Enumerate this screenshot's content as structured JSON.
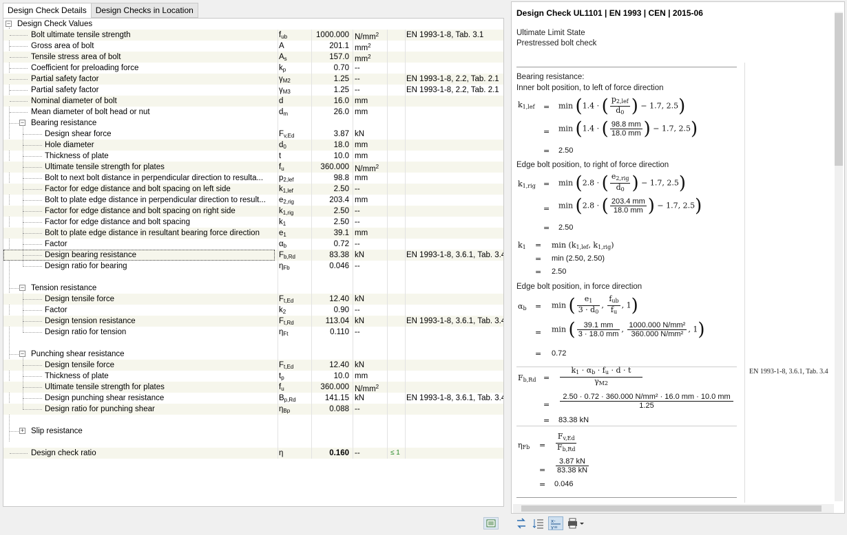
{
  "tabs": [
    "Design Check Details",
    "Design Checks in Location"
  ],
  "root_label": "Design Check Values",
  "rows": [
    {
      "lbl": "Bolt ultimate tensile strength",
      "sym": "f<sub>ub</sub>",
      "val": "1000.000",
      "unit": "N/mm<sup>2</sup>",
      "ref": "EN 1993-1-8, Tab. 3.1"
    },
    {
      "lbl": "Gross area of bolt",
      "sym": "A",
      "val": "201.1",
      "unit": "mm<sup>2</sup>",
      "ref": ""
    },
    {
      "lbl": "Tensile stress area of bolt",
      "sym": "A<sub>s</sub>",
      "val": "157.0",
      "unit": "mm<sup>2</sup>",
      "ref": ""
    },
    {
      "lbl": "Coefficient for preloading force",
      "sym": "k<sub>p</sub>",
      "val": "0.70",
      "unit": "--",
      "ref": ""
    },
    {
      "lbl": "Partial safety factor",
      "sym": "γ<sub>M2</sub>",
      "val": "1.25",
      "unit": "--",
      "ref": "EN 1993-1-8, 2.2, Tab. 2.1"
    },
    {
      "lbl": "Partial safety factor",
      "sym": "γ<sub>M3</sub>",
      "val": "1.25",
      "unit": "--",
      "ref": "EN 1993-1-8, 2.2, Tab. 2.1"
    },
    {
      "lbl": "Nominal diameter of bolt",
      "sym": "d",
      "val": "16.0",
      "unit": "mm",
      "ref": ""
    },
    {
      "lbl": "Mean diameter of bolt head or nut",
      "sym": "d<sub>m</sub>",
      "val": "26.0",
      "unit": "mm",
      "ref": ""
    },
    {
      "group": "Bearing resistance"
    },
    {
      "lbl": "Design shear force",
      "sym": "F<sub>v,Ed</sub>",
      "val": "3.87",
      "unit": "kN",
      "ref": "",
      "lvl": 2
    },
    {
      "lbl": "Hole diameter",
      "sym": "d<sub>0</sub>",
      "val": "18.0",
      "unit": "mm",
      "ref": "",
      "lvl": 2
    },
    {
      "lbl": "Thickness of plate",
      "sym": "t",
      "val": "10.0",
      "unit": "mm",
      "ref": "",
      "lvl": 2
    },
    {
      "lbl": "Ultimate tensile strength for plates",
      "sym": "f<sub>u</sub>",
      "val": "360.000",
      "unit": "N/mm<sup>2</sup>",
      "ref": "",
      "lvl": 2
    },
    {
      "lbl": "Bolt to next bolt distance in perpendicular direction to resulta...",
      "sym": "p<sub>2,lef</sub>",
      "val": "98.8",
      "unit": "mm",
      "ref": "",
      "lvl": 2
    },
    {
      "lbl": "Factor for edge distance and bolt spacing on left side",
      "sym": "k<sub>1,lef</sub>",
      "val": "2.50",
      "unit": "--",
      "ref": "",
      "lvl": 2
    },
    {
      "lbl": "Bolt to plate edge distance in perpendicular direction to result...",
      "sym": "e<sub>2,rig</sub>",
      "val": "203.4",
      "unit": "mm",
      "ref": "",
      "lvl": 2
    },
    {
      "lbl": "Factor for edge distance and bolt spacing on right side",
      "sym": "k<sub>1,rig</sub>",
      "val": "2.50",
      "unit": "--",
      "ref": "",
      "lvl": 2
    },
    {
      "lbl": "Factor for edge distance and bolt spacing",
      "sym": "k<sub>1</sub>",
      "val": "2.50",
      "unit": "--",
      "ref": "",
      "lvl": 2
    },
    {
      "lbl": "Bolt to plate edge distance in resultant bearing force direction",
      "sym": "e<sub>1</sub>",
      "val": "39.1",
      "unit": "mm",
      "ref": "",
      "lvl": 2
    },
    {
      "lbl": "Factor",
      "sym": "α<sub>b</sub>",
      "val": "0.72",
      "unit": "--",
      "ref": "",
      "lvl": 2
    },
    {
      "lbl": "Design bearing resistance",
      "sym": "F<sub>b,Rd</sub>",
      "val": "83.38",
      "unit": "kN",
      "ref": "EN 1993-1-8, 3.6.1, Tab. 3.4",
      "lvl": 2,
      "sel": true
    },
    {
      "lbl": "Design ratio for bearing",
      "sym": "η<sub>Fb</sub>",
      "val": "0.046",
      "unit": "--",
      "ref": "",
      "lvl": 2
    },
    {
      "blank": true
    },
    {
      "group": "Tension resistance"
    },
    {
      "lbl": "Design tensile force",
      "sym": "F<sub>t,Ed</sub>",
      "val": "12.40",
      "unit": "kN",
      "ref": "",
      "lvl": 2
    },
    {
      "lbl": "Factor",
      "sym": "k<sub>2</sub>",
      "val": "0.90",
      "unit": "--",
      "ref": "",
      "lvl": 2
    },
    {
      "lbl": "Design tension resistance",
      "sym": "F<sub>t,Rd</sub>",
      "val": "113.04",
      "unit": "kN",
      "ref": "EN 1993-1-8, 3.6.1, Tab. 3.4",
      "lvl": 2
    },
    {
      "lbl": "Design ratio for tension",
      "sym": "η<sub>Ft</sub>",
      "val": "0.110",
      "unit": "--",
      "ref": "",
      "lvl": 2
    },
    {
      "blank": true
    },
    {
      "group": "Punching shear resistance"
    },
    {
      "lbl": "Design tensile force",
      "sym": "F<sub>t,Ed</sub>",
      "val": "12.40",
      "unit": "kN",
      "ref": "",
      "lvl": 2
    },
    {
      "lbl": "Thickness of plate",
      "sym": "t<sub>p</sub>",
      "val": "10.0",
      "unit": "mm",
      "ref": "",
      "lvl": 2
    },
    {
      "lbl": "Ultimate tensile strength for plates",
      "sym": "f<sub>u</sub>",
      "val": "360.000",
      "unit": "N/mm<sup>2</sup>",
      "ref": "",
      "lvl": 2
    },
    {
      "lbl": "Design punching shear resistance",
      "sym": "B<sub>p,Rd</sub>",
      "val": "141.15",
      "unit": "kN",
      "ref": "EN 1993-1-8, 3.6.1, Tab. 3.4",
      "lvl": 2
    },
    {
      "lbl": "Design ratio for punching shear",
      "sym": "η<sub>Bp</sub>",
      "val": "0.088",
      "unit": "--",
      "ref": "",
      "lvl": 2
    },
    {
      "blank": true
    },
    {
      "group": "Slip resistance",
      "collapsed": true
    },
    {
      "blank": true
    },
    {
      "lbl": "Design check ratio",
      "sym": "η",
      "val": "0.160",
      "unit": "--",
      "ref": "",
      "chk": "≤ 1",
      "bold": true
    }
  ],
  "details": {
    "title": "Design Check UL1101 | EN 1993 | CEN | 2015-06",
    "lines": [
      "Ultimate Limit State",
      "Prestressed bolt check"
    ],
    "bearing": "Bearing resistance:",
    "inner": "Inner bolt position, to left of force direction",
    "edge_right": "Edge bolt position, to right of force direction",
    "edge_force": "Edge bolt position, in force direction",
    "ref": "EN 1993-1-8, 3.6.1, Tab. 3.4",
    "k1lef_r1": "1.7, 2.5",
    "k1lef_v1": "98.8 mm",
    "k1lef_v2": "18.0 mm",
    "k1lef_res": "2.50",
    "k1rig_v1": "203.4 mm",
    "k1rig_v2": "18.0 mm",
    "k1rig_res": "2.50",
    "k1_l2": "min (2.50, 2.50)",
    "k1_res": "2.50",
    "ab_v1": "39.1 mm",
    "ab_v2": "18.0 mm",
    "ab_v3": "1000.000 N/mm²",
    "ab_v4": "360.000 N/mm²",
    "ab_res": "0.72",
    "fb_num": "2.50 · 0.72 · 360.000 N/mm² · 16.0 mm · 10.0 mm",
    "fb_den": "1.25",
    "fb_res": "83.38 kN",
    "eta_num": "3.87 kN",
    "eta_den": "83.38 kN",
    "eta_res": "0.046"
  }
}
